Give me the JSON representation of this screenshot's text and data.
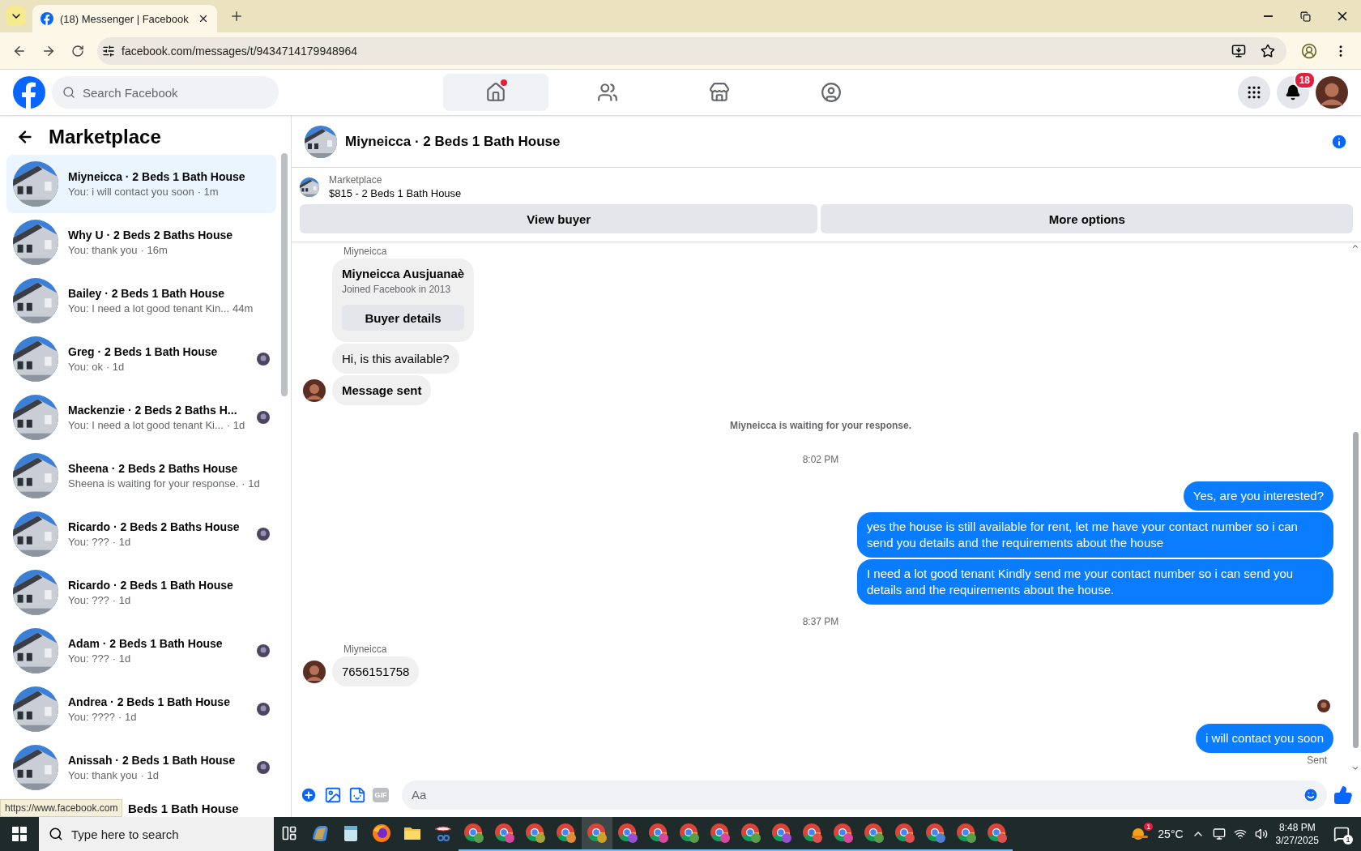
{
  "browser": {
    "tab_title": "(18) Messenger | Facebook",
    "url": "facebook.com/messages/t/9434714179948964"
  },
  "header": {
    "search_placeholder": "Search Facebook",
    "nav": [
      {
        "kind": "home",
        "selected": true,
        "dot": true
      },
      {
        "kind": "friends",
        "selected": false,
        "dot": false
      },
      {
        "kind": "marketplace",
        "selected": false,
        "dot": false
      },
      {
        "kind": "groups",
        "selected": false,
        "dot": false
      }
    ],
    "notification_count": "18"
  },
  "sidebar": {
    "title": "Marketplace",
    "items": [
      {
        "title": "Miyneicca · 2 Beds 1 Bath House",
        "preview": "You: i will contact you soon",
        "time": "· 1m",
        "selected": true,
        "seen": false
      },
      {
        "title": "Why U · 2 Beds 2 Baths House",
        "preview": "You: thank you",
        "time": "· 16m",
        "selected": false,
        "seen": false
      },
      {
        "title": "Bailey · 2 Beds 1 Bath House",
        "preview": "You: I need a lot good tenant Kin...",
        "time": "44m",
        "selected": false,
        "seen": false
      },
      {
        "title": "Greg · 2 Beds 1 Bath House",
        "preview": "You: ok",
        "time": "· 1d",
        "selected": false,
        "seen": true
      },
      {
        "title": "Mackenzie · 2 Beds 2 Baths H...",
        "preview": "You: I need a lot good tenant Ki...",
        "time": "· 1d",
        "selected": false,
        "seen": true
      },
      {
        "title": "Sheena · 2 Beds 2 Baths House",
        "preview": "Sheena is waiting for your response.",
        "time": "· 1d",
        "selected": false,
        "seen": false
      },
      {
        "title": "Ricardo · 2 Beds 2 Baths House",
        "preview": "You: ???",
        "time": "· 1d",
        "selected": false,
        "seen": true
      },
      {
        "title": "Ricardo · 2 Beds 1 Bath House",
        "preview": "You: ???",
        "time": "· 1d",
        "selected": false,
        "seen": false
      },
      {
        "title": "Adam · 2 Beds 1 Bath House",
        "preview": "You: ???",
        "time": "· 1d",
        "selected": false,
        "seen": true
      },
      {
        "title": "Andrea · 2 Beds 1 Bath House",
        "preview": "You: ????",
        "time": "· 1d",
        "selected": false,
        "seen": true
      },
      {
        "title": "Anissah · 2 Beds 1 Bath House",
        "preview": "You: thank you",
        "time": "· 1d",
        "selected": false,
        "seen": true
      }
    ],
    "partial_item": "Beds 1 Bath House",
    "status_url": "https://www.facebook.com"
  },
  "chat": {
    "title": "Miyneicca · 2 Beds 1 Bath House",
    "listing": {
      "source": "Marketplace",
      "name": "$815 - 2 Beds 1 Bath House"
    },
    "actions": [
      "View buyer",
      "More options"
    ],
    "messages": [
      {
        "kind": "sender",
        "text": "Miyneicca"
      },
      {
        "kind": "card",
        "name": "Miyneicca Ausjuanaè",
        "joined": "Joined Facebook in 2013",
        "button": "Buyer details"
      },
      {
        "kind": "in",
        "text": "Hi, is this available?",
        "avatar": false,
        "bold": false
      },
      {
        "kind": "in",
        "text": "Message sent",
        "avatar": true,
        "bold": true
      },
      {
        "kind": "notice",
        "text": "Miyneicca is waiting for your response."
      },
      {
        "kind": "time",
        "text": "8:02 PM"
      },
      {
        "kind": "out",
        "text": "Yes, are you interested?"
      },
      {
        "kind": "out",
        "text": "yes the house is still available for rent, let me have your contact number so i can send you details and the requirements about the house"
      },
      {
        "kind": "out",
        "text": "I need a lot good tenant Kindly send me your contact number so i can send you details and the requirements about the house."
      },
      {
        "kind": "time",
        "text": "8:37 PM"
      },
      {
        "kind": "sender",
        "text": "Miyneicca"
      },
      {
        "kind": "in",
        "text": "7656151758",
        "avatar": true,
        "bold": false
      },
      {
        "kind": "receipt"
      },
      {
        "kind": "out",
        "text": "i will contact you soon"
      },
      {
        "kind": "status",
        "text": "Sent"
      }
    ],
    "composer": {
      "gif": "GIF",
      "placeholder": "Aa"
    }
  },
  "taskbar": {
    "search_placeholder": "Type here to search",
    "apps": [
      {
        "kind": "copilot",
        "selected": false
      },
      {
        "kind": "notepad",
        "selected": false
      },
      {
        "kind": "firefox",
        "selected": false
      },
      {
        "kind": "folder",
        "selected": false
      },
      {
        "kind": "snip",
        "selected": false
      },
      {
        "kind": "chrome",
        "color": "#5a9e4b",
        "selected": false
      },
      {
        "kind": "chrome",
        "color": "#d9479e",
        "selected": false
      },
      {
        "kind": "chrome",
        "color": "#a5a33a",
        "selected": false
      },
      {
        "kind": "chrome",
        "color": "#e08a3c",
        "selected": false
      },
      {
        "kind": "chrome",
        "color": "#c9a227",
        "selected": true
      },
      {
        "kind": "chrome",
        "color": "#9c4fd6",
        "selected": false
      },
      {
        "kind": "chrome",
        "color": "#d9479e",
        "selected": false
      },
      {
        "kind": "chrome",
        "color": "#5a9e4b",
        "selected": false
      },
      {
        "kind": "chrome",
        "color": "#d9479e",
        "selected": false
      },
      {
        "kind": "chrome",
        "color": "#5a9e4b",
        "selected": false
      },
      {
        "kind": "chrome",
        "color": "#9c4fd6",
        "selected": false
      },
      {
        "kind": "chrome",
        "color": "#e05050",
        "selected": false
      },
      {
        "kind": "chrome",
        "color": "#d9479e",
        "selected": false
      },
      {
        "kind": "chrome",
        "color": "#5a9e4b",
        "selected": false
      },
      {
        "kind": "chrome",
        "color": "#e05050",
        "selected": false
      },
      {
        "kind": "chrome",
        "color": "#4f7fd6",
        "selected": false
      },
      {
        "kind": "chrome",
        "color": "#5a9e4b",
        "selected": false
      },
      {
        "kind": "chrome",
        "color": "#e05050",
        "selected": false
      }
    ],
    "weather_badge": "1",
    "temperature": "25°C",
    "time": "8:48 PM",
    "date": "3/27/2025",
    "notification_count": "1"
  }
}
